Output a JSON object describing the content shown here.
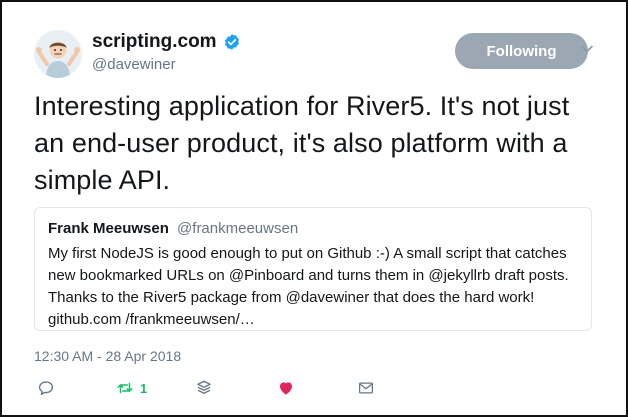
{
  "author": {
    "display_name": "scripting.com",
    "handle": "@davewiner",
    "avatar_icon": "shrug-emoji-avatar",
    "verified_icon": "verified-badge-icon"
  },
  "follow_button": {
    "label": "Following"
  },
  "tweet": {
    "text": "Interesting application for River5. It's not just an end-user product, it's also platform with a simple API."
  },
  "quoted_tweet": {
    "name": "Frank Meeuwsen",
    "handle": "@frankmeeuwsen",
    "text": "My first NodeJS is good enough to put on Github :-) A small script that catches new bookmarked URLs on @Pinboard and turns them in @jekyllrb draft posts. Thanks to the River5 package from @davewiner that does the hard work! github.com /frankmeeuwsen/…"
  },
  "timestamp": "12:30 AM - 28 Apr 2018",
  "actions": {
    "retweet_count": "1",
    "icons": [
      "reply-icon",
      "retweet-icon",
      "stack-icon",
      "like-icon",
      "message-icon"
    ]
  },
  "colors": {
    "verified": "#1da1f2",
    "following_button": "#9ba8b3",
    "retweet": "#17bf63",
    "like": "#e0245e",
    "muted": "#657786"
  }
}
